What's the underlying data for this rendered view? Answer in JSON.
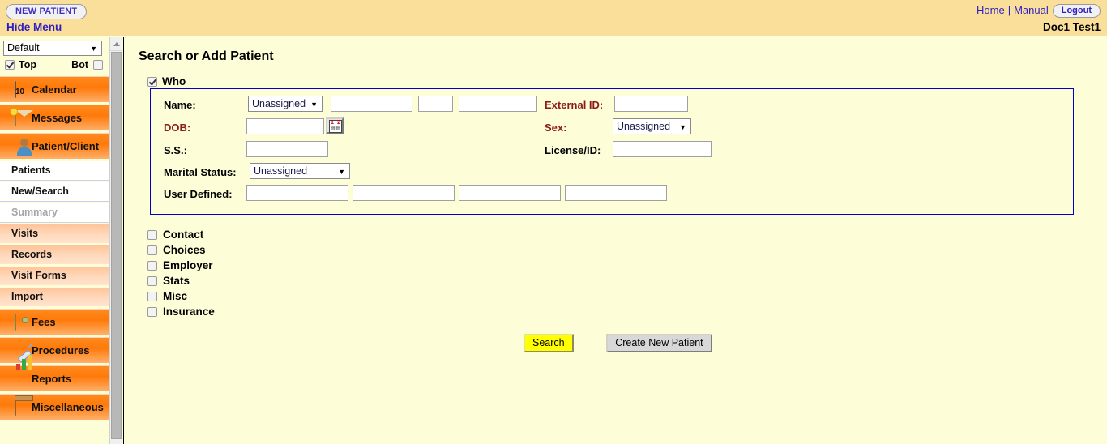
{
  "header": {
    "new_patient_label": "NEW PATIENT",
    "hide_menu_label": "Hide Menu",
    "home_label": "Home",
    "separator": "|",
    "manual_label": "Manual",
    "logout_label": "Logout",
    "user_name": "Doc1 Test1"
  },
  "sidebar": {
    "theme_select": {
      "value": "Default",
      "caret": "▼"
    },
    "position_checkboxes": [
      {
        "label": "Top",
        "checked": true
      },
      {
        "label": "Bot",
        "checked": false
      }
    ],
    "items": [
      {
        "label": "Calendar",
        "type": "main",
        "icon": "calendar-icon",
        "icon_text": "10"
      },
      {
        "label": "Messages",
        "type": "main",
        "icon": "envelope-icon"
      },
      {
        "label": "Patient/Client",
        "type": "main",
        "icon": "person-icon"
      },
      {
        "label": "Patients",
        "type": "sub",
        "style": "white"
      },
      {
        "label": "New/Search",
        "type": "sub",
        "style": "white"
      },
      {
        "label": "Summary",
        "type": "sub",
        "style": "disabled"
      },
      {
        "label": "Visits",
        "type": "sub",
        "style": "peach"
      },
      {
        "label": "Records",
        "type": "sub",
        "style": "peach"
      },
      {
        "label": "Visit Forms",
        "type": "sub",
        "style": "peach"
      },
      {
        "label": "Import",
        "type": "sub",
        "style": "peach"
      },
      {
        "label": "Fees",
        "type": "main",
        "icon": "money-icon"
      },
      {
        "label": "Procedures",
        "type": "main",
        "icon": "syringe-icon"
      },
      {
        "label": "Reports",
        "type": "main",
        "icon": "bar-chart-icon"
      },
      {
        "label": "Miscellaneous",
        "type": "main",
        "icon": "box-icon"
      }
    ]
  },
  "main": {
    "page_title": "Search or Add Patient",
    "who_section": {
      "label": "Who",
      "checked": true,
      "fields": {
        "name_label": "Name:",
        "name_prefix_value": "Unassigned",
        "name_first_value": "",
        "name_middle_value": "",
        "name_last_value": "",
        "dob_label": "DOB:",
        "dob_value": "",
        "date_picker_icon": "calendar-picker-icon",
        "ss_label": "S.S.:",
        "ss_value": "",
        "marital_label": "Marital Status:",
        "marital_value": "Unassigned",
        "user_defined_label": "User Defined:",
        "user_defined_values": [
          "",
          "",
          "",
          ""
        ],
        "external_id_label": "External ID:",
        "external_id_value": "",
        "sex_label": "Sex:",
        "sex_value": "Unassigned",
        "license_label": "License/ID:",
        "license_value": ""
      }
    },
    "section_checkboxes": [
      {
        "label": "Contact",
        "checked": false
      },
      {
        "label": "Choices",
        "checked": false
      },
      {
        "label": "Employer",
        "checked": false
      },
      {
        "label": "Stats",
        "checked": false
      },
      {
        "label": "Misc",
        "checked": false
      },
      {
        "label": "Insurance",
        "checked": false
      }
    ],
    "buttons": {
      "search_label": "Search",
      "create_label": "Create New Patient"
    }
  },
  "colors": {
    "header_bg": "#fadf9a",
    "content_bg": "#fdfdd8",
    "accent_orange": "#ff7a0a",
    "link_blue": "#2b1ec6",
    "fieldset_border": "#0000cc",
    "label_red": "#8b1a1a",
    "search_highlight": "#ffff00"
  }
}
